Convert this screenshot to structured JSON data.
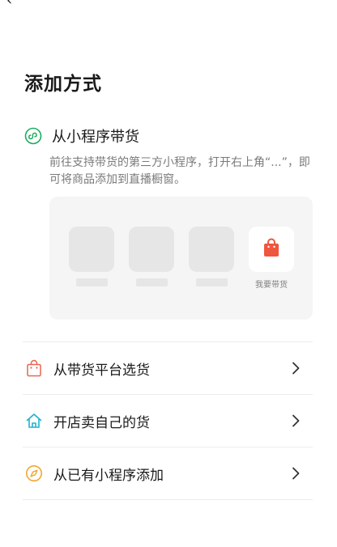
{
  "nav": {
    "back_glyph": "‹"
  },
  "title": "添加方式",
  "section1": {
    "title": "从小程序带货",
    "description": "前往支持带货的第三方小程序，打开右上角“...”，即可将商品添加到直播橱窗。",
    "icon": "mini-program-icon",
    "preview": {
      "shop_label": "我要带货",
      "shop_icon": "shopping-bag-icon",
      "accent": "#f0553d"
    }
  },
  "options": [
    {
      "label": "从带货平台选货",
      "icon": "shopping-bag-outline-icon",
      "color": "#e8664f"
    },
    {
      "label": "开店卖自己的货",
      "icon": "house-icon",
      "color": "#1fb3d1"
    },
    {
      "label": "从已有小程序添加",
      "icon": "compass-icon",
      "color": "#f0a836"
    }
  ],
  "colors": {
    "mini_program": "#1aad5f",
    "chevron": "#333333"
  }
}
